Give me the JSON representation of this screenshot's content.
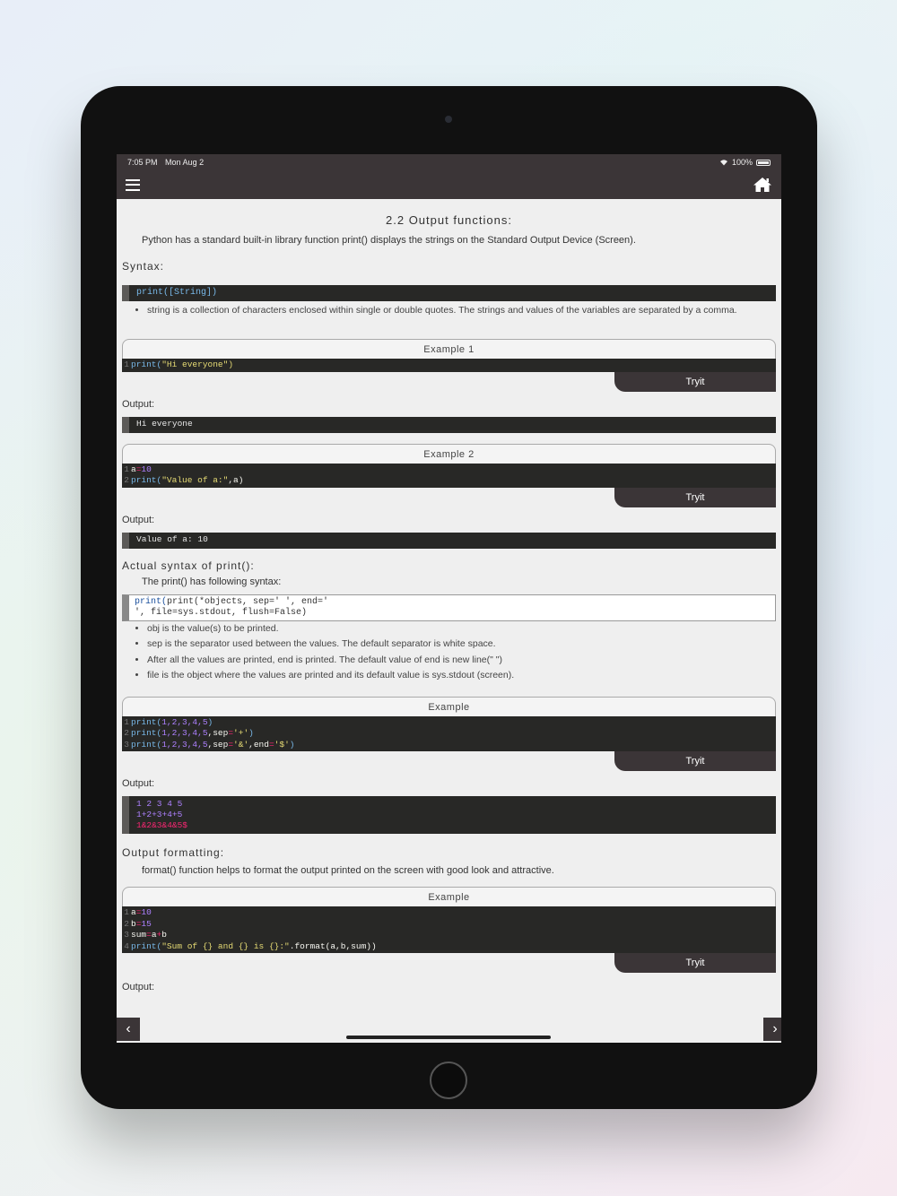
{
  "status": {
    "time": "7:05 PM",
    "date": "Mon Aug 2",
    "battery": "100%"
  },
  "nav": {
    "menu_icon": "hamburger-icon",
    "home_icon": "home-icon"
  },
  "page": {
    "title": "2.2 Output functions:",
    "intro": "Python has a standard built-in library function print() displays the strings on the Standard Output Device (Screen).",
    "syntax_heading": "Syntax:",
    "syntax_code": "print([String])",
    "syntax_bullet": "string is a collection of characters enclosed within single or double quotes. The strings and values of the variables are separated by a comma.",
    "output_label": "Output:",
    "tryit_label": "Tryit"
  },
  "examples": [
    {
      "title": "Example 1",
      "lines": [
        "print(\"Hi everyone\")"
      ],
      "output": [
        "Hi everyone"
      ]
    },
    {
      "title": "Example 2",
      "lines": [
        "a=10",
        "print(\"Value of a:\",a)"
      ],
      "output": [
        "Value of a: 10"
      ]
    },
    {
      "title": "Example",
      "lines": [
        "print(1,2,3,4,5)",
        "print(1,2,3,4,5,sep='+')",
        "print(1,2,3,4,5,sep='&',end='$')"
      ],
      "output": [
        "1 2 3 4 5",
        "1+2+3+4+5",
        "1&2&3&4&5$"
      ]
    },
    {
      "title": "Example",
      "lines": [
        "a=10",
        "b=15",
        "sum=a+b",
        "print(\"Sum of {} and {} is {}:\".format(a,b,sum))"
      ]
    }
  ],
  "actual_syntax": {
    "heading": "Actual syntax of print():",
    "subtext": "The print() has following syntax:",
    "code_line1": "print(*objects, sep=' ', end='",
    "code_line2": "', file=sys.stdout, flush=False)",
    "bullets": [
      "obj is the value(s) to be printed.",
      "sep is the separator used between the values. The default separator is white space.",
      "After all the values are printed, end is printed. The default value of end is new line(\" \")",
      "file is the object where the values are printed and its default value is sys.stdout (screen)."
    ]
  },
  "formatting": {
    "heading": "Output formatting:",
    "text": "format() function helps to format the output printed on the screen with good look and attractive."
  },
  "bottom": {
    "prev_icon": "chevron-left-icon",
    "next_icon": "chevron-right-icon",
    "prev_glyph": "‹",
    "next_glyph": "›"
  }
}
